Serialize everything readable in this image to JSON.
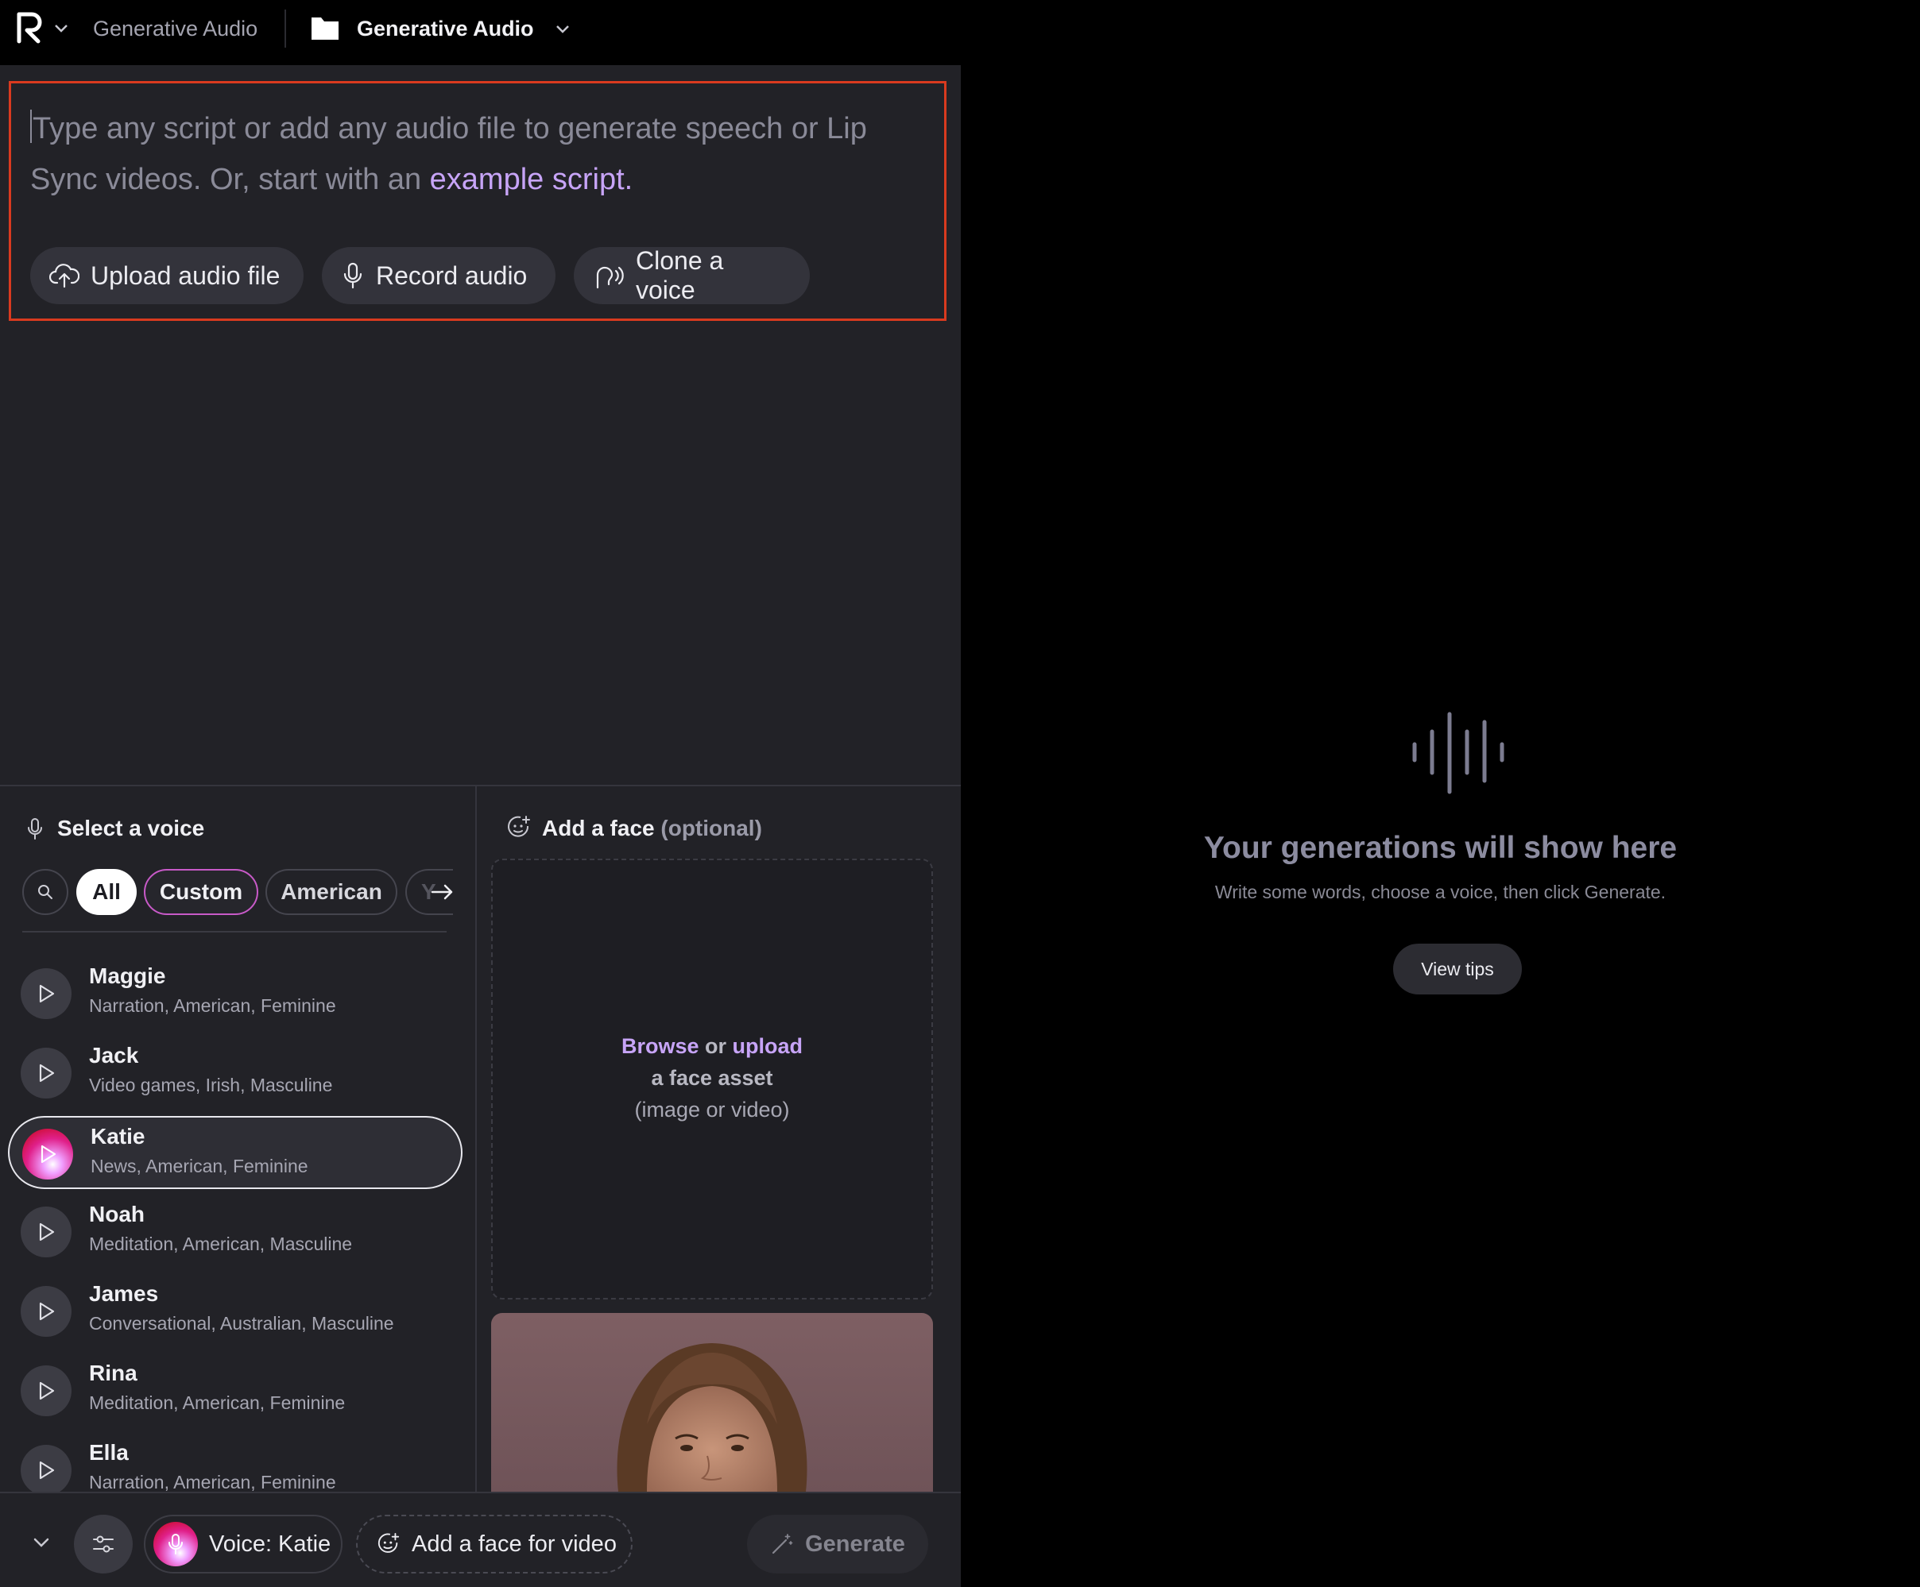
{
  "topbar": {
    "app_title": "Generative Audio",
    "project_title": "Generative Audio",
    "logo_icon": "runway-logo-icon",
    "folder_icon": "folder-icon"
  },
  "editor": {
    "placeholder_before": "Type any script or add any audio file to generate speech or Lip Sync videos. Or, start with an ",
    "placeholder_link": "example script",
    "placeholder_after": ".",
    "buttons": {
      "upload": "Upload audio file",
      "record": "Record audio",
      "clone": "Clone a voice"
    }
  },
  "voices": {
    "heading": "Select a voice",
    "filters": [
      "All",
      "Custom",
      "American",
      "Y"
    ],
    "active_filter": "All",
    "items": [
      {
        "name": "Maggie",
        "tags": "Narration, American, Feminine"
      },
      {
        "name": "Jack",
        "tags": "Video games, Irish, Masculine"
      },
      {
        "name": "Katie",
        "tags": "News, American, Feminine",
        "selected": true
      },
      {
        "name": "Noah",
        "tags": "Meditation, American, Masculine"
      },
      {
        "name": "James",
        "tags": "Conversational, Australian, Masculine"
      },
      {
        "name": "Rina",
        "tags": "Meditation, American, Feminine"
      },
      {
        "name": "Ella",
        "tags": "Narration, American, Feminine"
      }
    ]
  },
  "face": {
    "heading": "Add a face",
    "optional": "(optional)",
    "browse": "Browse",
    "or": "or",
    "upload": "upload",
    "line2": "a face asset",
    "line3": "(image or video)"
  },
  "bottom": {
    "voice_label": "Voice: Katie",
    "face_label": "Add a face for video",
    "generate_label": "Generate"
  },
  "empty_state": {
    "title": "Your generations will show here",
    "subtitle": "Write some words, choose a voice, then click Generate.",
    "tips_button": "View tips"
  },
  "colors": {
    "accent": "#c7a4f7",
    "highlight_border": "#d93a1f",
    "panel_bg": "#222227"
  }
}
